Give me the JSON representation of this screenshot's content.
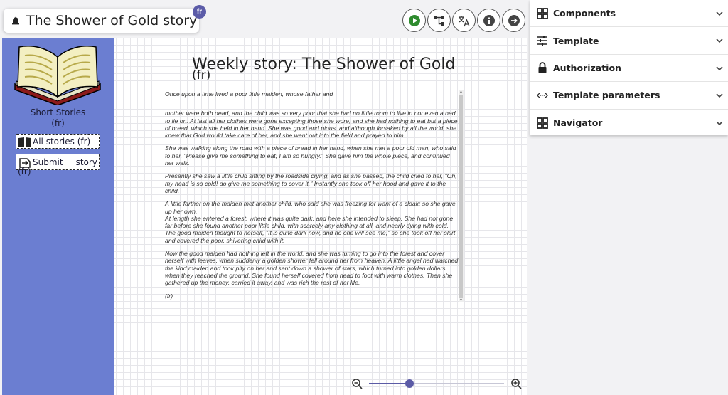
{
  "header": {
    "title": "The Shower of Gold story",
    "language_badge": "fr"
  },
  "toolbar": {
    "buttons": [
      {
        "name": "play-icon"
      },
      {
        "name": "hierarchy-icon"
      },
      {
        "name": "translate-icon"
      },
      {
        "name": "info-icon"
      },
      {
        "name": "arrow-right-icon"
      }
    ]
  },
  "sidebar": {
    "section_title": "Short Stories",
    "section_title_fr": "(fr)",
    "all_stories_label": "All stories (fr)",
    "submit_label_1": "Submit",
    "submit_label_2": "story",
    "submit_label_fr": "(fr)"
  },
  "story": {
    "title": "Weekly story: The Shower of Gold",
    "title_fr": "(fr)",
    "paragraphs": [
      "Once upon a time lived a poor little maiden, whose father and",
      "mother were both dead, and the child was so very poor that she had no little room to live in nor even a bed to lie on. At last all her clothes were gone excepting those she wore, and she had nothing to eat but a piece of bread, which she held in her hand. She was good and pious, and although forsaken by all the world, she knew that God would take care of her, and she went out into the field and prayed to him.",
      "She was walking along the road with a piece of bread in her hand, when she met a poor old man, who said to her, \"Please give me something to eat; I am so hungry.\" She gave him the whole piece, and continued her walk.",
      "Presently she saw a little child sitting by the roadside crying, and as she passed, the child cried to her, \"Oh, my head is so cold! do give me something to cover it.\" Instantly she took off her hood and gave it to the child.",
      "A little farther on the maiden met another child, who said she was freezing for want of a cloak; so she gave up her own.",
      "At length she entered a forest, where it was quite dark, and here she intended to sleep. She had not gone far before she found another poor little child, with scarcely any clothing at all, and nearly dying with cold. The good maiden thought to herself, \"It is quite dark now, and no one will see me,\" so she took off her skirt and covered the poor, shivering child with it.",
      "Now the good maiden had nothing left in the world, and she was turning to go into the forest and cover herself with leaves, when suddenly a golden shower fell around her from heaven. A little angel had watched the kind maiden and took pity on her and sent down a shower of stars, which turned into golden dollars when they reached the ground. She found herself covered from head to foot with warm clothes. Then she gathered up the money, carried it away, and was rich the rest of her life.",
      " (fr)"
    ]
  },
  "zoom": {
    "level_fraction": 0.3
  },
  "panel": {
    "sections": [
      {
        "label": "Components",
        "icon": "grid-icon"
      },
      {
        "label": "Template",
        "icon": "sliders-icon"
      },
      {
        "label": "Authorization",
        "icon": "lock-icon"
      },
      {
        "label": "Template parameters",
        "icon": "code-icon"
      },
      {
        "label": "Navigator",
        "icon": "grid-icon"
      }
    ]
  },
  "colors": {
    "sidebar": "#6b7ed1",
    "accent": "#5b5ba6",
    "play": "#2e8b2e"
  }
}
